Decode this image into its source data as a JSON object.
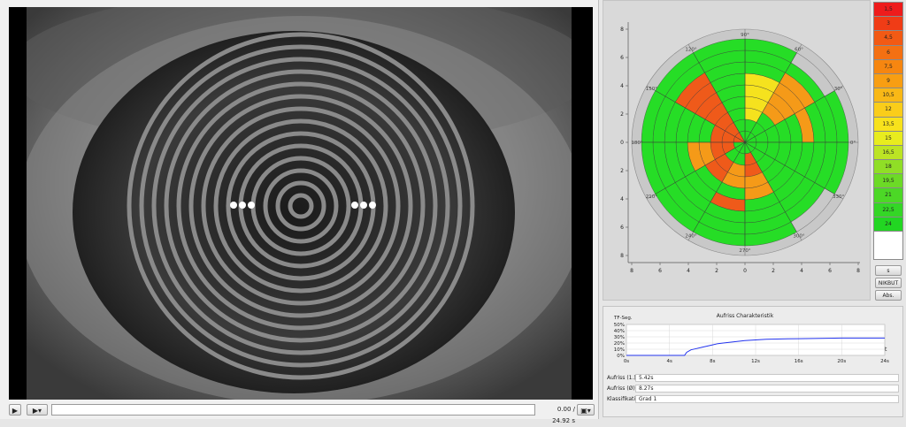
{
  "video": {
    "play_icon": "play-icon",
    "step_icon": "step-menu-icon",
    "save_icon": "save-menu-icon",
    "time_readout": "0.00 / 24.92 s"
  },
  "polar": {
    "angle_labels": [
      "0°",
      "30°",
      "60°",
      "90°",
      "120°",
      "150°",
      "180°",
      "210°",
      "240°",
      "270°",
      "300°",
      "330°"
    ],
    "y_ticks": [
      "8",
      "6",
      "4",
      "2",
      "0",
      "2",
      "4",
      "6",
      "8"
    ],
    "x_ticks": [
      "8",
      "6",
      "4",
      "2",
      "0",
      "2",
      "4",
      "6",
      "8"
    ],
    "colors": {
      "green": "#26dd26",
      "red": "#ef5a1a",
      "orange": "#f59a18",
      "yellow": "#f5e21e",
      "grey": "#c8c8c8"
    }
  },
  "legend": {
    "items": [
      {
        "label": "1,5",
        "color": "#ee1c1c"
      },
      {
        "label": "3",
        "color": "#f03c16"
      },
      {
        "label": "4,5",
        "color": "#f25a14"
      },
      {
        "label": "6",
        "color": "#f47012"
      },
      {
        "label": "7,5",
        "color": "#f68610"
      },
      {
        "label": "9",
        "color": "#f89e12"
      },
      {
        "label": "10,5",
        "color": "#f9b816"
      },
      {
        "label": "12",
        "color": "#facd1a"
      },
      {
        "label": "13,5",
        "color": "#f8e21c"
      },
      {
        "label": "15",
        "color": "#e8ec1e"
      },
      {
        "label": "16,5",
        "color": "#bce424"
      },
      {
        "label": "18",
        "color": "#90de26"
      },
      {
        "label": "19,5",
        "color": "#6cda26"
      },
      {
        "label": "21",
        "color": "#4cd826"
      },
      {
        "label": "22,5",
        "color": "#34d626"
      },
      {
        "label": "24",
        "color": "#22d622"
      }
    ],
    "button_s": "s",
    "button_nikbut": "NIKBUT",
    "button_abs": "Abs."
  },
  "breakup": {
    "title": "Aufriss Charakteristik",
    "y_axis_label": "TF-Seg.",
    "x_axis_label": "t",
    "y_ticks": [
      "50%",
      "40%",
      "30%",
      "20%",
      "10%",
      "0%"
    ],
    "x_ticks": [
      "0s",
      "4s",
      "8s",
      "12s",
      "16s",
      "20s",
      "24s"
    ],
    "line_color": "#2233ee",
    "fields": [
      {
        "label": "Aufriss (1.):",
        "value": "5.42s"
      },
      {
        "label": "Aufriss (Ø):",
        "value": "8.27s"
      },
      {
        "label": "Klassifikation:",
        "value": "Grad 1"
      }
    ]
  },
  "chart_data": {
    "type": "line",
    "title": "Aufriss Charakteristik",
    "xlabel": "t",
    "ylabel": "TF-Seg.",
    "xlim": [
      0,
      24
    ],
    "ylim": [
      0,
      50
    ],
    "x": [
      0,
      4,
      5.4,
      5.6,
      6.0,
      6.5,
      7,
      7.5,
      8,
      8.5,
      9,
      10,
      11,
      12,
      13,
      14,
      16,
      18,
      20,
      22,
      24
    ],
    "values": [
      0,
      0,
      0,
      5,
      9,
      11,
      13,
      15,
      17,
      19,
      20,
      22,
      24,
      25,
      26,
      26.5,
      27,
      27.5,
      28,
      28,
      28
    ]
  }
}
